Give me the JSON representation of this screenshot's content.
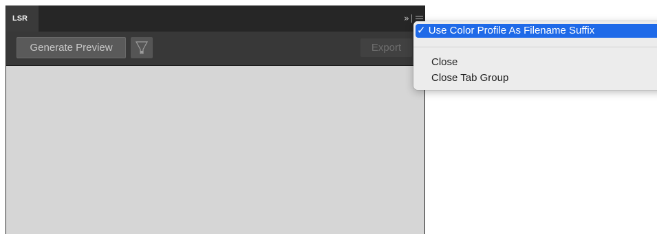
{
  "panel": {
    "tab_label": "LSR",
    "collapse_glyph": "»",
    "menu_icon": "hamburger-menu-icon"
  },
  "toolbar": {
    "generate_label": "Generate Preview",
    "filter_icon": "filter-funnel-icon",
    "export_label": "Export"
  },
  "flyout_menu": {
    "items": [
      {
        "label": "Use Color Profile As Filename Suffix",
        "checked": true,
        "highlighted": true
      },
      {
        "label": "Close"
      },
      {
        "label": "Close Tab Group"
      }
    ],
    "check_glyph": "✓"
  },
  "colors": {
    "tabbar_bg": "#262626",
    "toolbar_bg": "#383838",
    "content_bg": "#d6d6d6",
    "menu_highlight": "#1f6ae8"
  }
}
